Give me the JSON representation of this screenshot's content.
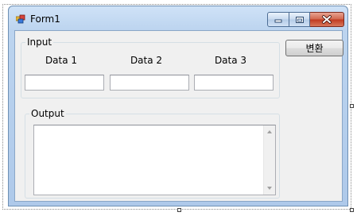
{
  "window": {
    "title": "Form1",
    "icon": "winforms-app-icon",
    "caption_buttons": [
      "minimize",
      "maximize",
      "close"
    ]
  },
  "input_group": {
    "label": "Input",
    "fields": [
      {
        "label": "Data 1",
        "value": ""
      },
      {
        "label": "Data 2",
        "value": ""
      },
      {
        "label": "Data 3",
        "value": ""
      }
    ]
  },
  "output_group": {
    "label": "Output",
    "value": ""
  },
  "convert_button": {
    "label": "변환"
  },
  "colors": {
    "title_bar": "#bcd4ef",
    "client_background": "#f0f0f0",
    "close_button": "#c0391f"
  }
}
